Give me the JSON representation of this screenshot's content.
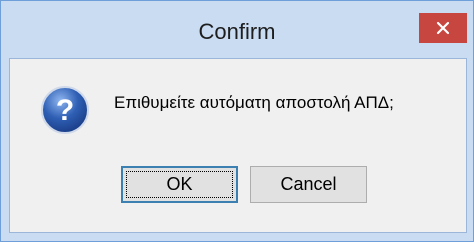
{
  "dialog": {
    "title": "Confirm",
    "message": "Επιθυμείτε αυτόματη αποστολή ΑΠΔ;",
    "icon": "question-icon",
    "ok_label": "OK",
    "cancel_label": "Cancel"
  },
  "colors": {
    "frame": "#c9dcf2",
    "close_button": "#c7463f",
    "icon_blue": "#2f5fb4",
    "focus_border": "#3c7fb1"
  }
}
